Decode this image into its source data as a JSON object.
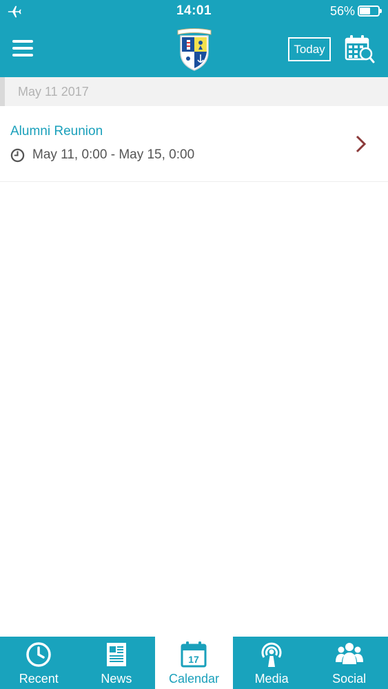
{
  "status_bar": {
    "time": "14:01",
    "battery": "56%",
    "battery_level": 0.56
  },
  "nav": {
    "today_label": "Today",
    "colors": {
      "bar": "#19a3bd",
      "accent": "#1aa0bb"
    }
  },
  "date_header": "May 11 2017",
  "events": [
    {
      "title": "Alumni Reunion",
      "time": "May 11, 0:00 - May 15, 0:00"
    }
  ],
  "tabs": [
    {
      "label": "Recent",
      "icon": "clock-icon",
      "active": false
    },
    {
      "label": "News",
      "icon": "newspaper-icon",
      "active": false
    },
    {
      "label": "Calendar",
      "icon": "calendar-icon",
      "date": "17",
      "active": true
    },
    {
      "label": "Media",
      "icon": "broadcast-icon",
      "active": false
    },
    {
      "label": "Social",
      "icon": "people-icon",
      "active": false
    }
  ]
}
